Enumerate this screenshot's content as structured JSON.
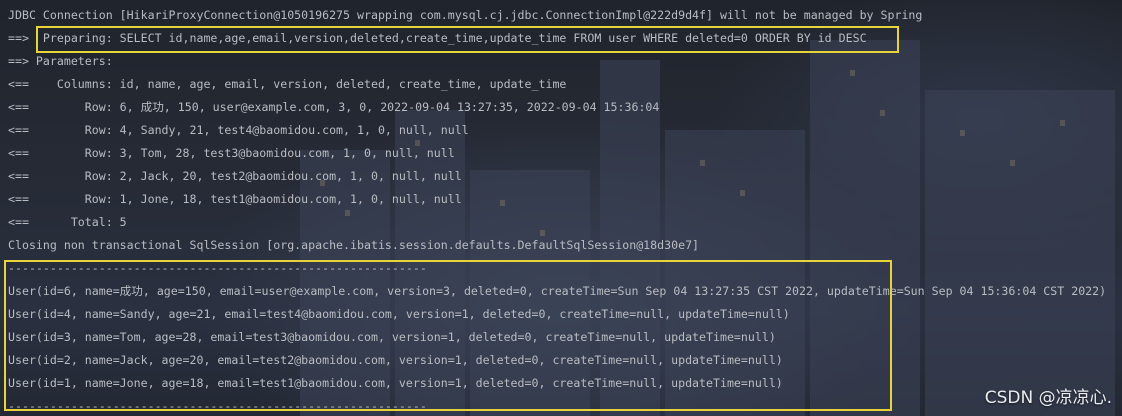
{
  "console": {
    "lines": [
      "JDBC Connection [HikariProxyConnection@1050196275 wrapping com.mysql.cj.jdbc.ConnectionImpl@222d9d4f] will not be managed by Spring",
      "==>  Preparing: SELECT id,name,age,email,version,deleted,create_time,update_time FROM user WHERE deleted=0 ORDER BY id DESC",
      "==> Parameters: ",
      "<==    Columns: id, name, age, email, version, deleted, create_time, update_time",
      "<==        Row: 6, 成功, 150, user@example.com, 3, 0, 2022-09-04 13:27:35, 2022-09-04 15:36:04",
      "<==        Row: 4, Sandy, 21, test4@baomidou.com, 1, 0, null, null",
      "<==        Row: 3, Tom, 28, test3@baomidou.com, 1, 0, null, null",
      "<==        Row: 2, Jack, 20, test2@baomidou.com, 1, 0, null, null",
      "<==        Row: 1, Jone, 18, test1@baomidou.com, 1, 0, null, null",
      "<==      Total: 5",
      "Closing non transactional SqlSession [org.apache.ibatis.session.defaults.DefaultSqlSession@18d30e7]",
      "------------------------------------------------------------",
      "User(id=6, name=成功, age=150, email=user@example.com, version=3, deleted=0, createTime=Sun Sep 04 13:27:35 CST 2022, updateTime=Sun Sep 04 15:36:04 CST 2022)",
      "User(id=4, name=Sandy, age=21, email=test4@baomidou.com, version=1, deleted=0, createTime=null, updateTime=null)",
      "User(id=3, name=Tom, age=28, email=test3@baomidou.com, version=1, deleted=0, createTime=null, updateTime=null)",
      "User(id=2, name=Jack, age=20, email=test2@baomidou.com, version=1, deleted=0, createTime=null, updateTime=null)",
      "User(id=1, name=Jone, age=18, email=test1@baomidou.com, version=1, deleted=0, createTime=null, updateTime=null)",
      "------------------------------------------------------------"
    ]
  },
  "highlight_color": "#e6d43a",
  "text_color": "#b9bcc2",
  "watermark": "CSDN @凉凉心."
}
